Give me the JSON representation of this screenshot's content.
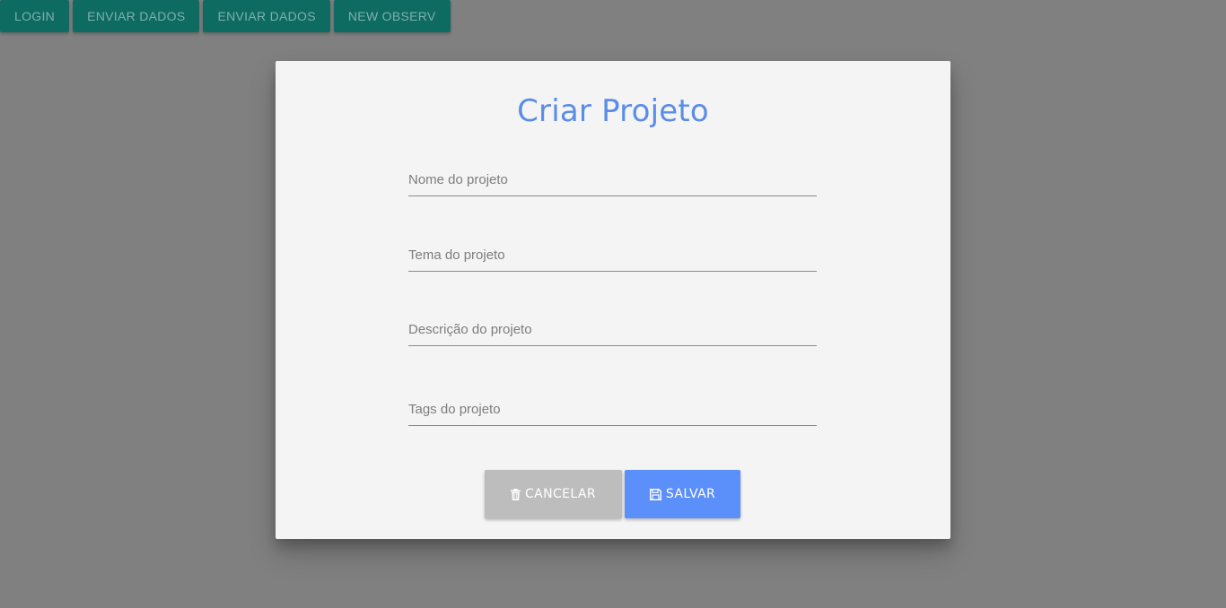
{
  "toolbar": {
    "buttons": [
      "LOGIN",
      "ENVIAR DADOS",
      "ENVIAR DADOS",
      "NEW OBSERV"
    ]
  },
  "modal": {
    "title": "Criar Projeto",
    "fields": [
      {
        "placeholder": "Nome do projeto",
        "value": ""
      },
      {
        "placeholder": "Tema do projeto",
        "value": ""
      },
      {
        "placeholder": "Descrição do projeto",
        "value": ""
      },
      {
        "placeholder": "Tags do projeto",
        "value": ""
      }
    ],
    "cancel_label": "CANCELAR",
    "save_label": "SALVAR",
    "cancel_icon": "trash-icon",
    "save_icon": "floppy-disk-icon"
  },
  "colors": {
    "overlay": "#808080",
    "title": "#5a8de8",
    "save_button": "#5b8ff9",
    "cancel_button": "#bdbdbd",
    "toolbar_button": "#0e6b62"
  }
}
